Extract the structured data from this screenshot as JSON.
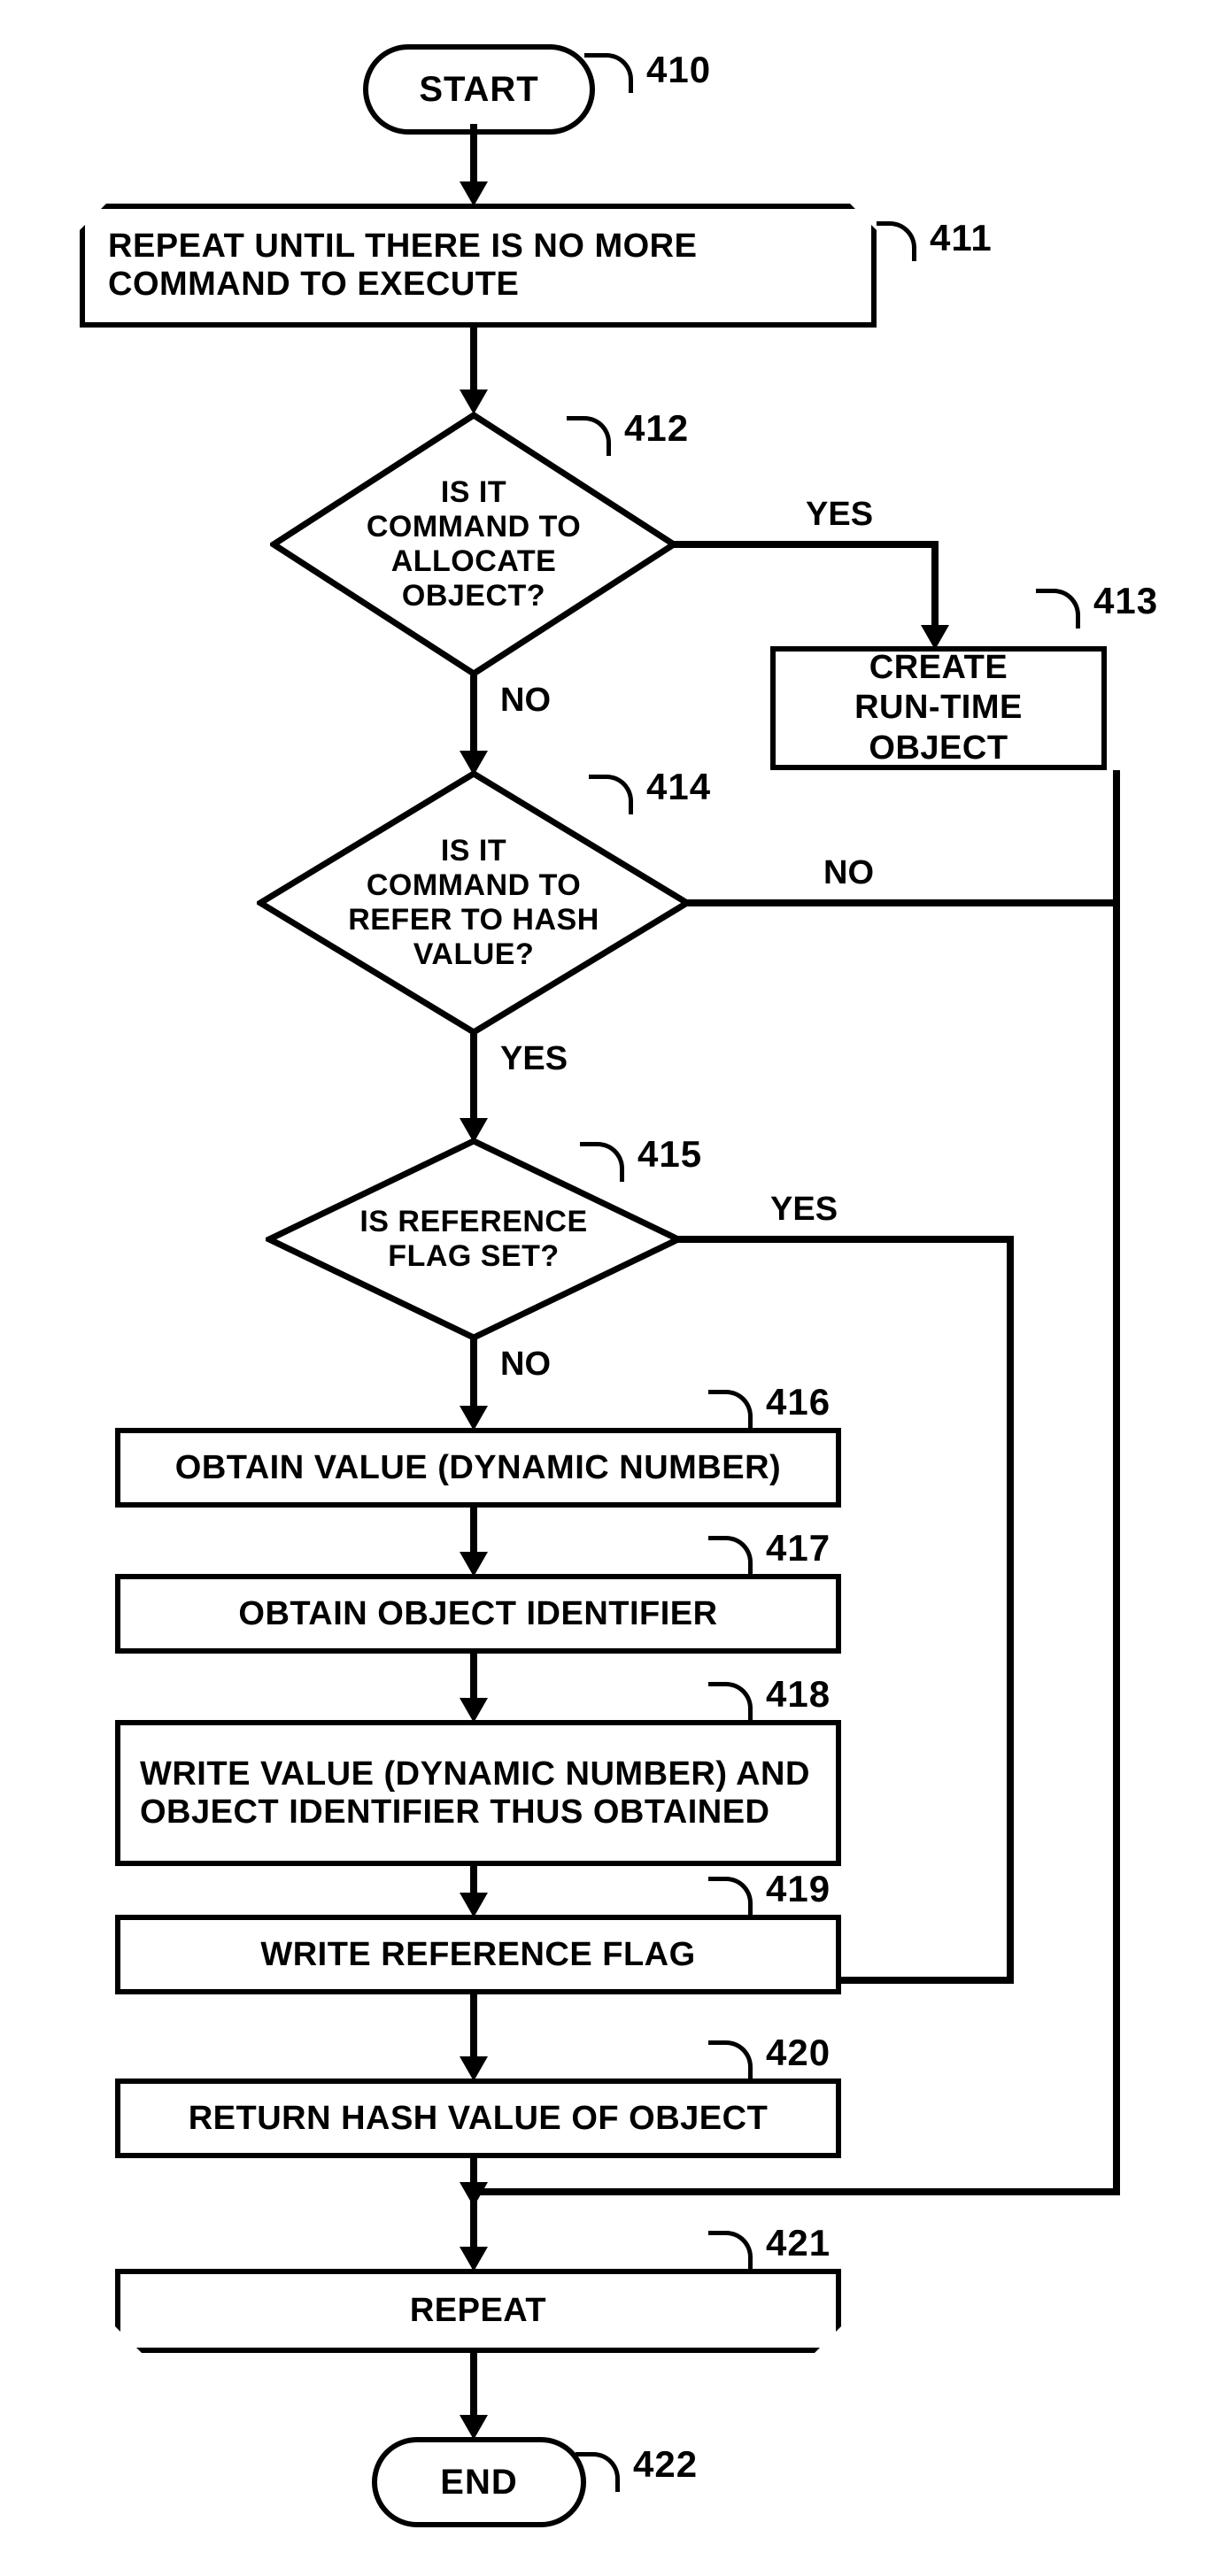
{
  "nodes": {
    "start": "START",
    "loop_start": "REPEAT UNTIL THERE IS NO MORE COMMAND TO EXECUTE",
    "d_allocate": "IS IT\nCOMMAND TO\nALLOCATE\nOBJECT?",
    "create_runtime": "CREATE\nRUN-TIME OBJECT",
    "d_hash": "IS IT\nCOMMAND TO\nREFER TO HASH\nVALUE?",
    "d_flag": "IS REFERENCE\nFLAG SET?",
    "obtain_value": "OBTAIN VALUE (DYNAMIC NUMBER)",
    "obtain_id": "OBTAIN OBJECT IDENTIFIER",
    "write_value": "WRITE VALUE (DYNAMIC NUMBER) AND OBJECT IDENTIFIER THUS OBTAINED",
    "write_flag": "WRITE REFERENCE FLAG",
    "return_hash": "RETURN HASH VALUE OF OBJECT",
    "loop_end": "REPEAT",
    "end": "END"
  },
  "labels": {
    "n410": "410",
    "n411": "411",
    "n412": "412",
    "n413": "413",
    "n414": "414",
    "n415": "415",
    "n416": "416",
    "n417": "417",
    "n418": "418",
    "n419": "419",
    "n420": "420",
    "n421": "421",
    "n422": "422"
  },
  "branch": {
    "yes": "YES",
    "no": "NO"
  }
}
